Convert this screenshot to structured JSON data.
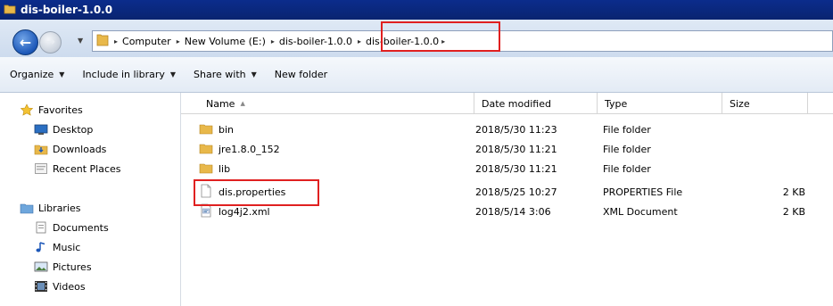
{
  "window": {
    "title": "dis-boiler-1.0.0"
  },
  "address": {
    "crumbs": [
      "Computer",
      "New Volume (E:)",
      "dis-boiler-1.0.0",
      "dis-boiler-1.0.0"
    ]
  },
  "toolbar": {
    "organize": "Organize",
    "include_in_library": "Include in library",
    "share_with": "Share with",
    "new_folder": "New folder"
  },
  "nav": {
    "favorites": "Favorites",
    "desktop": "Desktop",
    "downloads": "Downloads",
    "recent_places": "Recent Places",
    "libraries": "Libraries",
    "documents": "Documents",
    "music": "Music",
    "pictures": "Pictures",
    "videos": "Videos"
  },
  "columns": {
    "name": "Name",
    "date_modified": "Date modified",
    "type": "Type",
    "size": "Size"
  },
  "files": [
    {
      "name": "bin",
      "date": "2018/5/30 11:23",
      "type": "File folder",
      "size": ""
    },
    {
      "name": "jre1.8.0_152",
      "date": "2018/5/30 11:21",
      "type": "File folder",
      "size": ""
    },
    {
      "name": "lib",
      "date": "2018/5/30 11:21",
      "type": "File folder",
      "size": ""
    },
    {
      "name": "dis.properties",
      "date": "2018/5/25 10:27",
      "type": "PROPERTIES File",
      "size": "2 KB"
    },
    {
      "name": "log4j2.xml",
      "date": "2018/5/14 3:06",
      "type": "XML Document",
      "size": "2 KB"
    }
  ],
  "colors": {
    "title_bar": "#0a2470",
    "highlight_box": "#e02020",
    "folder": "#e8b84a"
  }
}
